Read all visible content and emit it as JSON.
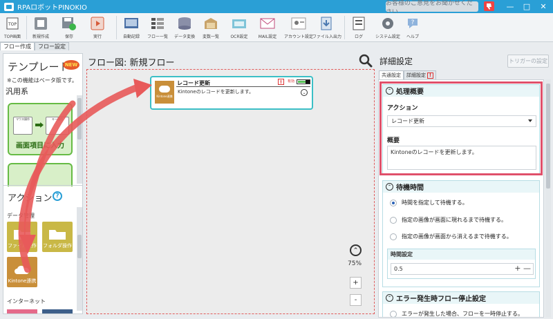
{
  "window": {
    "title": "RPAロボットPINOKIO",
    "feedback": "お客様のご意見をお聞かせください",
    "controls": [
      "—",
      "□",
      "✕"
    ]
  },
  "toolbar": {
    "items": [
      {
        "label": "TOP画面",
        "icon": "top-screen-icon"
      },
      {
        "label": "新規作成",
        "icon": "new-icon"
      },
      {
        "label": "保存",
        "icon": "save-icon"
      },
      {
        "label": "実行",
        "icon": "run-icon"
      },
      {
        "label": "自動記録",
        "icon": "record-icon"
      },
      {
        "label": "フロー一覧",
        "icon": "flow-list-icon"
      },
      {
        "label": "データ変換",
        "icon": "data-convert-icon"
      },
      {
        "label": "変数一覧",
        "icon": "variable-list-icon"
      },
      {
        "label": "OCR設定",
        "icon": "ocr-icon"
      },
      {
        "label": "MAIL設定",
        "icon": "mail-icon"
      },
      {
        "label": "アカウント設定",
        "icon": "account-icon"
      },
      {
        "label": "ファイル入出力",
        "icon": "file-io-icon"
      },
      {
        "label": "ログ",
        "icon": "log-icon"
      },
      {
        "label": "システム設定",
        "icon": "gear-icon"
      },
      {
        "label": "ヘルプ",
        "icon": "help-icon"
      }
    ]
  },
  "left_tabs": [
    "フロー作成",
    "フロー設定"
  ],
  "left": {
    "template_title": "テンプレート",
    "new_badge": "NEW",
    "beta_note": "※この機能はベータ版です。",
    "category": "汎用系",
    "template_card": {
      "label": "画面項目に入力",
      "mini1": "マウス操作",
      "mini2": "キー操作"
    },
    "action_title": "アクション",
    "help": "?",
    "subcategory": "データ管理",
    "tiles": [
      {
        "label": "ファイル操作",
        "color": "#c9b846"
      },
      {
        "label": "フォルダ操作",
        "color": "#c9b846"
      },
      {
        "label": "Kintone連携",
        "color": "#c98f3a"
      }
    ],
    "internet": "インターネット"
  },
  "flow": {
    "title": "フロー図:  新規フロー",
    "node": {
      "title": "レコード更新",
      "desc": "Kintoneのレコードを更新します。",
      "icon_label": "Kintone連携",
      "warn": "!",
      "enabled": "有効",
      "expand": "⌄"
    },
    "zoom": "75%",
    "zoom_in": "+",
    "zoom_out": "-",
    "zoom_up": "⌃"
  },
  "detail": {
    "title": "詳細設定",
    "trigger": "トリガーの設定",
    "tabs": [
      "共通設定",
      "詳細設定"
    ],
    "tab_warn": "!",
    "section1": {
      "title": "処理概要",
      "action_label": "アクション",
      "action_value": "レコード更新",
      "summary_label": "概要",
      "summary_value": "Kintoneのレコードを更新します。"
    },
    "section2": {
      "title": "待機時間",
      "options": [
        "時間を指定して待機する。",
        "指定の画像が画面に現れるまで待機する。",
        "指定の画像が画面から消えるまで待機する。"
      ],
      "selected": 0,
      "time_label": "時間設定",
      "time_value": "0.5",
      "pm": "+ —"
    },
    "section3": {
      "title": "エラー発生時フロー停止設定",
      "option": "エラーが発生した場合、フローを一時停止する。"
    }
  },
  "colors": {
    "titlebar": "#2a9fd6",
    "highlight": "#e0506a",
    "node_border": "#3bbfc6",
    "template_green": "#66bb44"
  }
}
